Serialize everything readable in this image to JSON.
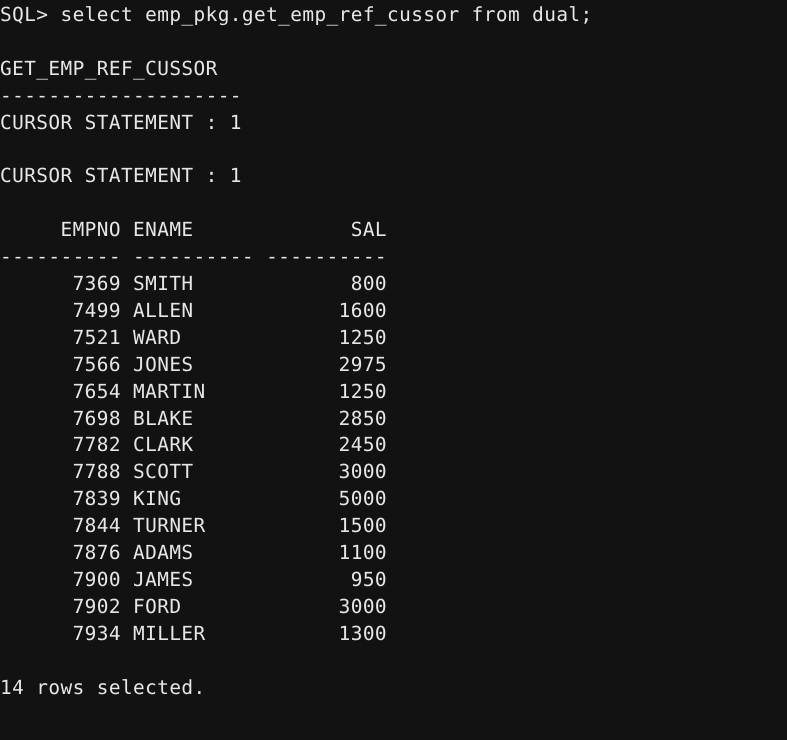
{
  "terminal": {
    "background_color": "#121212",
    "text_color": "#e6e6e6",
    "prompt": "SQL>",
    "command": "select emp_pkg.get_emp_ref_cussor from dual;",
    "command_line": "SQL> select emp_pkg.get_emp_ref_cussor from dual;",
    "result_column_header": "GET_EMP_REF_CUSSOR",
    "result_column_rule": "--------------------",
    "cursor_statement_lines": [
      "CURSOR STATEMENT : 1",
      "CURSOR STATEMENT : 1"
    ],
    "table": {
      "headers": [
        "EMPNO",
        "ENAME",
        "SAL"
      ],
      "header_line": "     EMPNO ENAME             SAL",
      "separator_line": "---------- ---------- ----------",
      "rows": [
        {
          "empno": "7369",
          "ename": "SMITH",
          "sal": "800",
          "line": "      7369 SMITH             800"
        },
        {
          "empno": "7499",
          "ename": "ALLEN",
          "sal": "1600",
          "line": "      7499 ALLEN            1600"
        },
        {
          "empno": "7521",
          "ename": "WARD",
          "sal": "1250",
          "line": "      7521 WARD             1250"
        },
        {
          "empno": "7566",
          "ename": "JONES",
          "sal": "2975",
          "line": "      7566 JONES            2975"
        },
        {
          "empno": "7654",
          "ename": "MARTIN",
          "sal": "1250",
          "line": "      7654 MARTIN           1250"
        },
        {
          "empno": "7698",
          "ename": "BLAKE",
          "sal": "2850",
          "line": "      7698 BLAKE            2850"
        },
        {
          "empno": "7782",
          "ename": "CLARK",
          "sal": "2450",
          "line": "      7782 CLARK            2450"
        },
        {
          "empno": "7788",
          "ename": "SCOTT",
          "sal": "3000",
          "line": "      7788 SCOTT            3000"
        },
        {
          "empno": "7839",
          "ename": "KING",
          "sal": "5000",
          "line": "      7839 KING             5000"
        },
        {
          "empno": "7844",
          "ename": "TURNER",
          "sal": "1500",
          "line": "      7844 TURNER           1500"
        },
        {
          "empno": "7876",
          "ename": "ADAMS",
          "sal": "1100",
          "line": "      7876 ADAMS            1100"
        },
        {
          "empno": "7900",
          "ename": "JAMES",
          "sal": "950",
          "line": "      7900 JAMES             950"
        },
        {
          "empno": "7902",
          "ename": "FORD",
          "sal": "3000",
          "line": "      7902 FORD             3000"
        },
        {
          "empno": "7934",
          "ename": "MILLER",
          "sal": "1300",
          "line": "      7934 MILLER           1300"
        }
      ]
    },
    "row_count_message": "14 rows selected.",
    "blank": ""
  }
}
